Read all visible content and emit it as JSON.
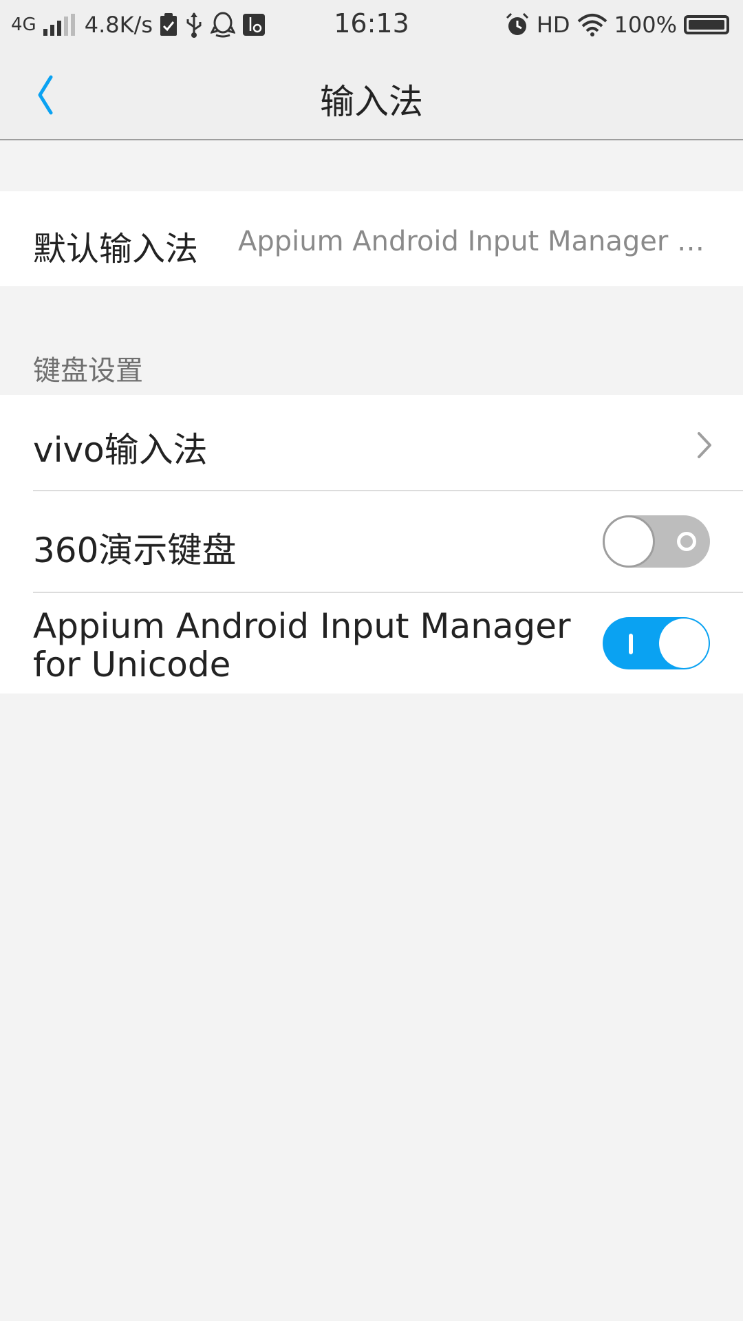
{
  "status_bar": {
    "network": "4G",
    "speed": "4.8K/s",
    "time": "16:13",
    "hd": "HD",
    "battery": "100%"
  },
  "header": {
    "title": "输入法"
  },
  "default_input": {
    "label": "默认输入法",
    "value": "Appium Android Input Manager for Unicode"
  },
  "keyboard_section": {
    "title": "键盘设置",
    "items": [
      {
        "label": "vivo输入法",
        "control": "chevron"
      },
      {
        "label": "360演示键盘",
        "control": "toggle",
        "enabled": false
      },
      {
        "label": "Appium Android Input Manager for Unicode",
        "control": "toggle",
        "enabled": true
      }
    ]
  },
  "colors": {
    "accent": "#0aa2f2",
    "background": "#f3f3f3",
    "toggle_off": "#bdbdbd"
  }
}
